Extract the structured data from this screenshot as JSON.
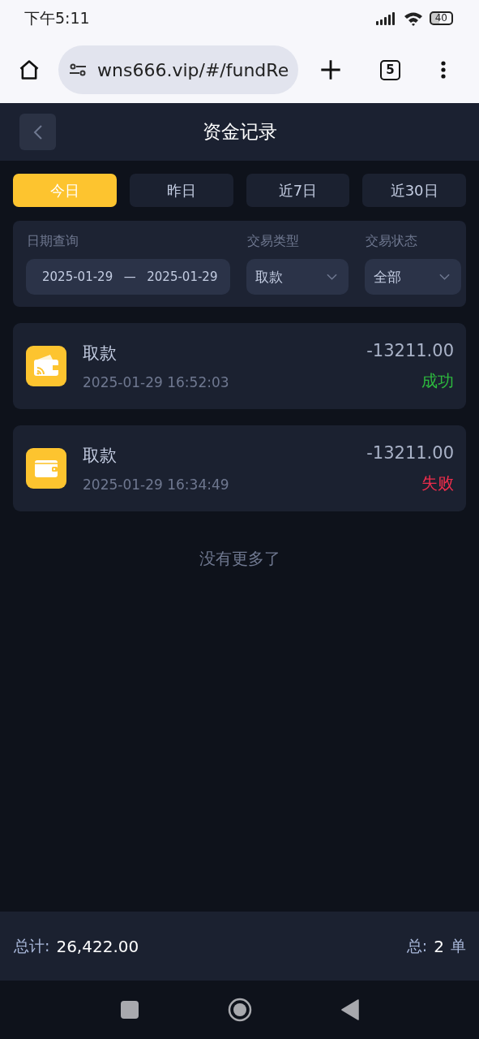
{
  "status_bar": {
    "time": "下午5:11",
    "battery": "40"
  },
  "browser": {
    "url": "wns666.vip/#/fundRe",
    "tab_count": "5"
  },
  "header": {
    "title": "资金记录"
  },
  "tabs": [
    {
      "label": "今日",
      "selected": true
    },
    {
      "label": "昨日",
      "selected": false
    },
    {
      "label": "近7日",
      "selected": false
    },
    {
      "label": "近30日",
      "selected": false
    }
  ],
  "filters": {
    "date_label": "日期查询",
    "date_from": "2025-01-29",
    "date_sep": "—",
    "date_to": "2025-01-29",
    "type_label": "交易类型",
    "type_value": "取款",
    "status_label": "交易状态",
    "status_value": "全部"
  },
  "records": [
    {
      "kind": "wallet-signal",
      "title": "取款",
      "time": "2025-01-29 16:52:03",
      "amount": "-13211.00",
      "status": "成功",
      "color": "#2dbb3e"
    },
    {
      "kind": "wallet",
      "title": "取款",
      "time": "2025-01-29 16:34:49",
      "amount": "-13211.00",
      "status": "失败",
      "color": "#ef2d4c"
    }
  ],
  "end_note": "没有更多了",
  "footer": {
    "total_label": "总计:",
    "total_value": "26,422.00",
    "count_label": "总:",
    "count_value": "2",
    "count_unit": "单"
  }
}
